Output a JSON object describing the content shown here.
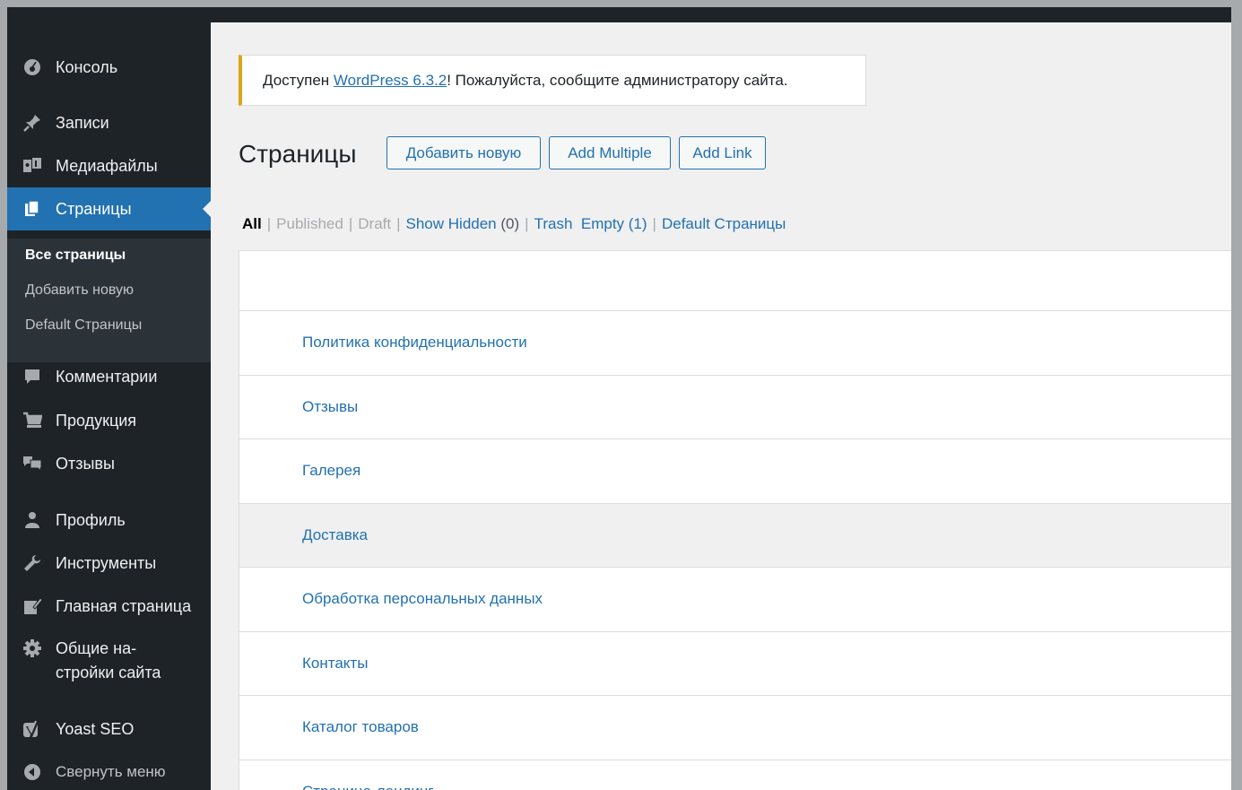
{
  "sidebar": {
    "items": [
      {
        "label": "Консоль",
        "icon": "dashboard-icon"
      },
      {
        "label": "Записи",
        "icon": "pin-icon"
      },
      {
        "label": "Медиафайлы",
        "icon": "media-icon"
      },
      {
        "label": "Страницы",
        "icon": "pages-icon"
      },
      {
        "label": "Комментарии",
        "icon": "comment-icon"
      },
      {
        "label": "Продукция",
        "icon": "cart-icon"
      },
      {
        "label": "Отзывы",
        "icon": "testimonials-icon"
      },
      {
        "label": "Профиль",
        "icon": "user-icon"
      },
      {
        "label": "Инструменты",
        "icon": "wrench-icon"
      },
      {
        "label": "Главная страница",
        "icon": "edit-page-icon"
      },
      {
        "label_line1": "Общие на-",
        "label_line2": "стройки сайта",
        "icon": "gear-icon"
      },
      {
        "label": "Yoast SEO",
        "icon": "yoast-icon"
      }
    ],
    "submenu": [
      "Все страницы",
      "Добавить новую",
      "Default Страницы"
    ],
    "collapse_label": "Свернуть меню"
  },
  "notice": {
    "prefix": "Доступен ",
    "link": "WordPress 6.3.2",
    "suffix": "! Пожалуйста, сообщите администратору сайта."
  },
  "page": {
    "title": "Страницы",
    "buttons": [
      "Добавить новую",
      "Add Multiple",
      "Add Link"
    ]
  },
  "filters": {
    "all": "All",
    "published": "Published",
    "draft": "Draft",
    "show_hidden": "Show Hidden",
    "hidden_count": "(0)",
    "trash": "Trash",
    "empty": "Empty (1)",
    "default": "Default Страницы"
  },
  "rows": [
    "Политика конфиденциальности",
    "Отзывы",
    "Галерея",
    "Доставка",
    "Обработка персональных данных",
    "Контакты",
    "Каталог товаров",
    "Страница-лендинг"
  ],
  "colors": {
    "accent": "#2271b1",
    "sidebar_bg": "#1d2327",
    "notice_border": "#dba617"
  }
}
